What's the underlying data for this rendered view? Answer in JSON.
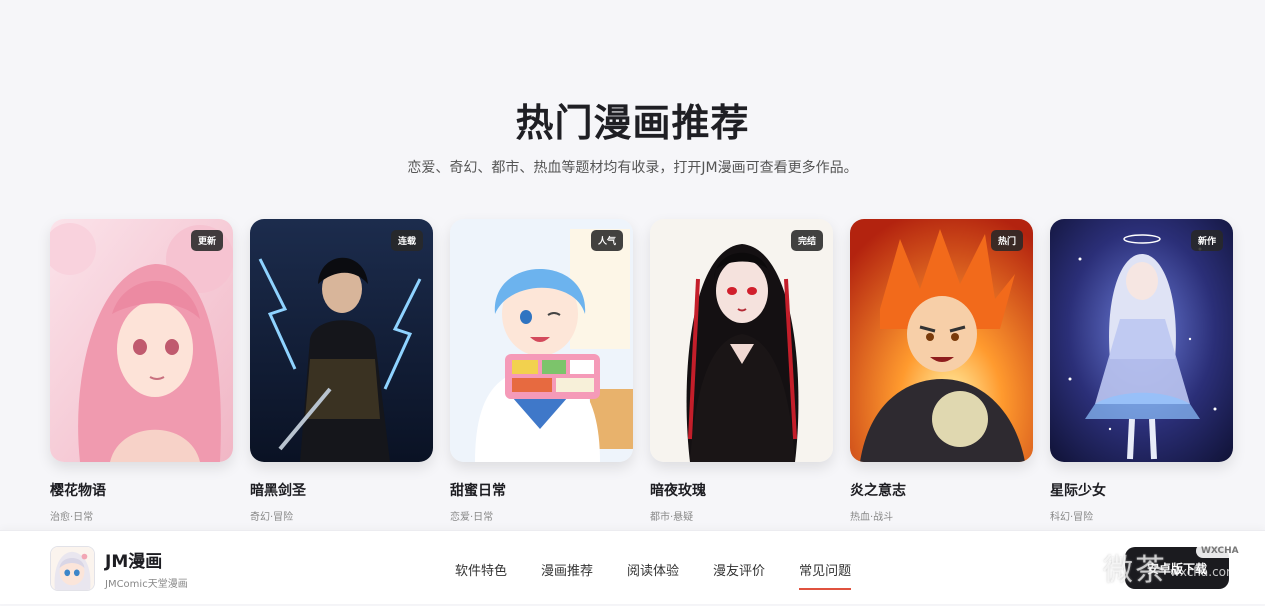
{
  "section": {
    "title": "热门漫画推荐",
    "subtitle": "恋爱、奇幻、都市、热血等题材均有收录，打开JM漫画可查看更多作品。"
  },
  "cards": [
    {
      "title": "樱花物语",
      "tags": "治愈·日常",
      "badge": "更新"
    },
    {
      "title": "暗黑剑圣",
      "tags": "奇幻·冒险",
      "badge": "连载"
    },
    {
      "title": "甜蜜日常",
      "tags": "恋爱·日常",
      "badge": "人气"
    },
    {
      "title": "暗夜玫瑰",
      "tags": "都市·悬疑",
      "badge": "完结"
    },
    {
      "title": "炎之意志",
      "tags": "热血·战斗",
      "badge": "热门"
    },
    {
      "title": "星际少女",
      "tags": "科幻·冒险",
      "badge": "新作"
    }
  ],
  "nav": {
    "brand_name": "JM漫画",
    "brand_sub": "JMComic天堂漫画",
    "links": [
      "软件特色",
      "漫画推荐",
      "阅读体验",
      "漫友评价",
      "常见问题"
    ],
    "active_index": 4,
    "download_label": "安卓版下载"
  },
  "watermark": {
    "text": "微茶",
    "url": "wxcha.com",
    "badge": "WXCHA"
  },
  "colors": {
    "accent": "#e0523f",
    "download_bg": "#1b1b1f"
  }
}
